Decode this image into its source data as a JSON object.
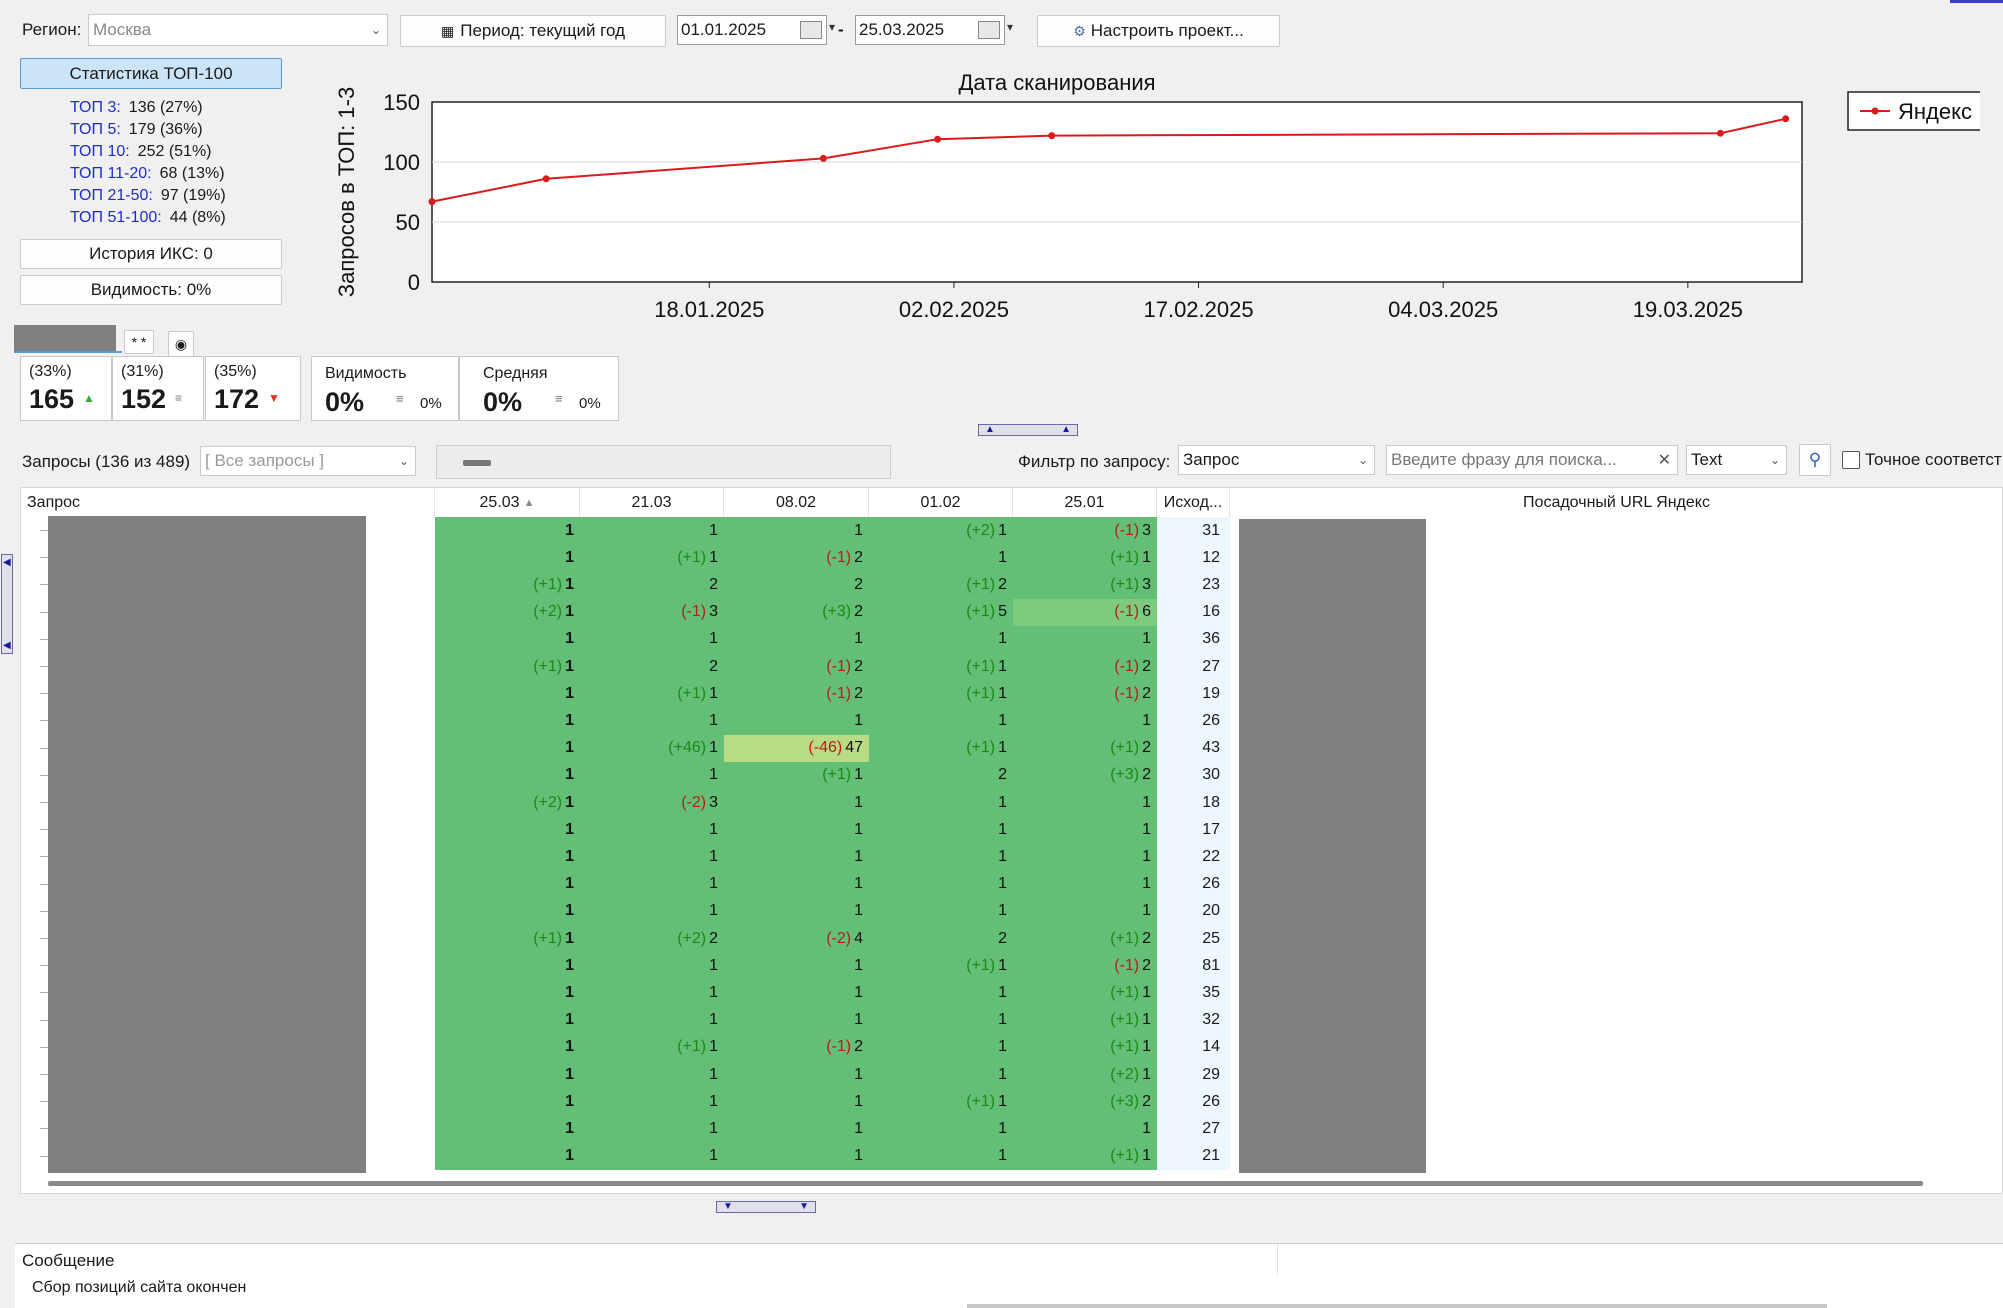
{
  "toolbar": {
    "region_label": "Регион:",
    "region_value": "Москва",
    "period_label": "Период: текущий год",
    "date_from": "01.01.2025",
    "date_sep": "-",
    "date_to": "25.03.2025",
    "configure_label": "Настроить проект..."
  },
  "left_panel": {
    "stats_button": "Статистика ТОП-100",
    "rows": [
      {
        "label": "ТОП 3:",
        "value": "136 (27%)"
      },
      {
        "label": "ТОП 5:",
        "value": "179 (36%)"
      },
      {
        "label": "ТОП 10:",
        "value": "252 (51%)"
      },
      {
        "label": "ТОП 11-20:",
        "value": "68 (13%)"
      },
      {
        "label": "ТОП 21-50:",
        "value": "97 (19%)"
      },
      {
        "label": "ТОП 51-100:",
        "value": "44 (8%)"
      }
    ],
    "iks_button": "История ИКС: 0",
    "visibility_button": "Видимость: 0%",
    "mini_tab": "* *"
  },
  "cards": [
    {
      "pct": "(33%)",
      "value": "165",
      "trend": "up"
    },
    {
      "pct": "(31%)",
      "value": "152",
      "trend": "same"
    },
    {
      "pct": "(35%)",
      "value": "172",
      "trend": "down"
    }
  ],
  "metrics": [
    {
      "label": "Видимость",
      "value": "0%",
      "delta": "0%"
    },
    {
      "label": "Средняя",
      "value": "0%",
      "delta": "0%"
    }
  ],
  "chart_data": {
    "type": "line",
    "title": "Дата сканирования",
    "ylabel": "Запросов в ТОП: 1-3",
    "xlabel": "",
    "ylim": [
      0,
      150
    ],
    "yticks": [
      "150",
      "100",
      "50",
      "0"
    ],
    "xticks": [
      "18.01.2025",
      "02.02.2025",
      "17.02.2025",
      "04.03.2025",
      "19.03.2025"
    ],
    "series": [
      {
        "name": "Яндекс",
        "color": "#d81b1b",
        "x": [
          "01.01.2025",
          "08.01.2025",
          "25.01.2025",
          "01.02.2025",
          "08.02.2025",
          "21.03.2025",
          "25.03.2025"
        ],
        "values": [
          67,
          86,
          103,
          119,
          122,
          124,
          136
        ]
      }
    ],
    "legend": "right"
  },
  "filter_bar": {
    "queries_label": "Запросы (136 из 489)",
    "queries_combo": "[ Все запросы ]",
    "filter_label": "Фильтр по запросу:",
    "filter_combo": "Запрос",
    "search_placeholder": "Введите фразу для поиска...",
    "type_combo": "Text",
    "exact_label": "Точное соответст"
  },
  "table": {
    "headers": [
      "Запрос",
      "25.03",
      "21.03",
      "08.02",
      "01.02",
      "25.01",
      "Исход...",
      "Посадочный URL Яндекс"
    ],
    "rows": [
      [
        [
          "",
          "1"
        ],
        [
          "",
          "1"
        ],
        [
          "",
          "1"
        ],
        [
          "(+2)",
          "1"
        ],
        [
          "(-1)",
          "3"
        ],
        "31"
      ],
      [
        [
          "",
          "1"
        ],
        [
          "(+1)",
          "1"
        ],
        [
          "(-1)",
          "2"
        ],
        [
          "",
          "1"
        ],
        [
          "(+1)",
          "1"
        ],
        "12"
      ],
      [
        [
          "(+1)",
          "1"
        ],
        [
          "",
          "2"
        ],
        [
          "",
          "2"
        ],
        [
          "(+1)",
          "2"
        ],
        [
          "(+1)",
          "3"
        ],
        "23"
      ],
      [
        [
          "(+2)",
          "1"
        ],
        [
          "(-1)",
          "3"
        ],
        [
          "(+3)",
          "2"
        ],
        [
          "(+1)",
          "5"
        ],
        [
          "(-1)",
          "6"
        ],
        "16"
      ],
      [
        [
          "",
          "1"
        ],
        [
          "",
          "1"
        ],
        [
          "",
          "1"
        ],
        [
          "",
          "1"
        ],
        [
          "",
          "1"
        ],
        "36"
      ],
      [
        [
          "(+1)",
          "1"
        ],
        [
          "",
          "2"
        ],
        [
          "(-1)",
          "2"
        ],
        [
          "(+1)",
          "1"
        ],
        [
          "(-1)",
          "2"
        ],
        "27"
      ],
      [
        [
          "",
          "1"
        ],
        [
          "(+1)",
          "1"
        ],
        [
          "(-1)",
          "2"
        ],
        [
          "(+1)",
          "1"
        ],
        [
          "(-1)",
          "2"
        ],
        "19"
      ],
      [
        [
          "",
          "1"
        ],
        [
          "",
          "1"
        ],
        [
          "",
          "1"
        ],
        [
          "",
          "1"
        ],
        [
          "",
          "1"
        ],
        "26"
      ],
      [
        [
          "",
          "1"
        ],
        [
          "(+46)",
          "1"
        ],
        [
          "(-46)",
          "47"
        ],
        [
          "(+1)",
          "1"
        ],
        [
          "(+1)",
          "2"
        ],
        "43"
      ],
      [
        [
          "",
          "1"
        ],
        [
          "",
          "1"
        ],
        [
          "(+1)",
          "1"
        ],
        [
          "",
          "2"
        ],
        [
          "(+3)",
          "2"
        ],
        "30"
      ],
      [
        [
          "(+2)",
          "1"
        ],
        [
          "(-2)",
          "3"
        ],
        [
          "",
          "1"
        ],
        [
          "",
          "1"
        ],
        [
          "",
          "1"
        ],
        "18"
      ],
      [
        [
          "",
          "1"
        ],
        [
          "",
          "1"
        ],
        [
          "",
          "1"
        ],
        [
          "",
          "1"
        ],
        [
          "",
          "1"
        ],
        "17"
      ],
      [
        [
          "",
          "1"
        ],
        [
          "",
          "1"
        ],
        [
          "",
          "1"
        ],
        [
          "",
          "1"
        ],
        [
          "",
          "1"
        ],
        "22"
      ],
      [
        [
          "",
          "1"
        ],
        [
          "",
          "1"
        ],
        [
          "",
          "1"
        ],
        [
          "",
          "1"
        ],
        [
          "",
          "1"
        ],
        "26"
      ],
      [
        [
          "",
          "1"
        ],
        [
          "",
          "1"
        ],
        [
          "",
          "1"
        ],
        [
          "",
          "1"
        ],
        [
          "",
          "1"
        ],
        "20"
      ],
      [
        [
          "(+1)",
          "1"
        ],
        [
          "(+2)",
          "2"
        ],
        [
          "(-2)",
          "4"
        ],
        [
          "",
          "2"
        ],
        [
          "(+1)",
          "2"
        ],
        "25"
      ],
      [
        [
          "",
          "1"
        ],
        [
          "",
          "1"
        ],
        [
          "",
          "1"
        ],
        [
          "(+1)",
          "1"
        ],
        [
          "(-1)",
          "2"
        ],
        "81"
      ],
      [
        [
          "",
          "1"
        ],
        [
          "",
          "1"
        ],
        [
          "",
          "1"
        ],
        [
          "",
          "1"
        ],
        [
          "(+1)",
          "1"
        ],
        "35"
      ],
      [
        [
          "",
          "1"
        ],
        [
          "",
          "1"
        ],
        [
          "",
          "1"
        ],
        [
          "",
          "1"
        ],
        [
          "(+1)",
          "1"
        ],
        "32"
      ],
      [
        [
          "",
          "1"
        ],
        [
          "(+1)",
          "1"
        ],
        [
          "(-1)",
          "2"
        ],
        [
          "",
          "1"
        ],
        [
          "(+1)",
          "1"
        ],
        "14"
      ],
      [
        [
          "",
          "1"
        ],
        [
          "",
          "1"
        ],
        [
          "",
          "1"
        ],
        [
          "",
          "1"
        ],
        [
          "(+2)",
          "1"
        ],
        "29"
      ],
      [
        [
          "",
          "1"
        ],
        [
          "",
          "1"
        ],
        [
          "",
          "1"
        ],
        [
          "(+1)",
          "1"
        ],
        [
          "(+3)",
          "2"
        ],
        "26"
      ],
      [
        [
          "",
          "1"
        ],
        [
          "",
          "1"
        ],
        [
          "",
          "1"
        ],
        [
          "",
          "1"
        ],
        [
          "",
          "1"
        ],
        "27"
      ],
      [
        [
          "",
          "1"
        ],
        [
          "",
          "1"
        ],
        [
          "",
          "1"
        ],
        [
          "",
          "1"
        ],
        [
          "(+1)",
          "1"
        ],
        "21"
      ]
    ],
    "colors": {
      "good": "#63bf75",
      "mid": "#7ccb7f",
      "warn": "#b8dc86",
      "orig_bg": "#eef6ff"
    }
  },
  "message": {
    "header": "Сообщение",
    "text": "Сбор позиций сайта окончен"
  }
}
